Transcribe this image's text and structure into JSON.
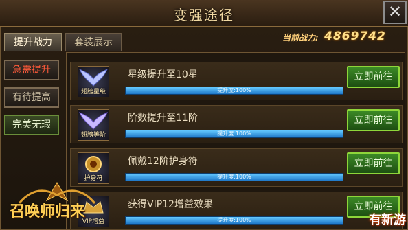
{
  "window": {
    "title": "变强途径",
    "close_symbol": "✕"
  },
  "tabs": [
    {
      "label": "提升战力",
      "active": true
    },
    {
      "label": "套装展示",
      "active": false
    }
  ],
  "power": {
    "label": "当前战力:",
    "value": "4869742"
  },
  "categories": [
    {
      "label": "急需提升",
      "color": "#ff5a3a"
    },
    {
      "label": "有待提高",
      "color": "#cfc2a6"
    },
    {
      "label": "完美无瑕",
      "color": "#e8f3d0"
    }
  ],
  "tasks": [
    {
      "icon": "wing-star-icon",
      "icon_caption": "翅膀星级",
      "text": "星级提升至10星",
      "progress_text": "提升度:100%",
      "progress": 1.0,
      "button": "立即前往"
    },
    {
      "icon": "wing-level-icon",
      "icon_caption": "翅膀等阶",
      "text": "阶数提升至11阶",
      "progress_text": "提升度:100%",
      "progress": 1.0,
      "button": "立即前往"
    },
    {
      "icon": "amulet-icon",
      "icon_caption": "护身符",
      "text": "佩戴12阶护身符",
      "progress_text": "提升度:100%",
      "progress": 1.0,
      "button": "立即前往"
    },
    {
      "icon": "vip-bonus-icon",
      "icon_caption": "VIP增益",
      "text": "获得VIP12增益效果",
      "progress_text": "提升度:100%",
      "progress": 1.0,
      "button": "立即前往"
    }
  ],
  "logo": {
    "text": "召唤师归来"
  },
  "watermark": "有新游"
}
